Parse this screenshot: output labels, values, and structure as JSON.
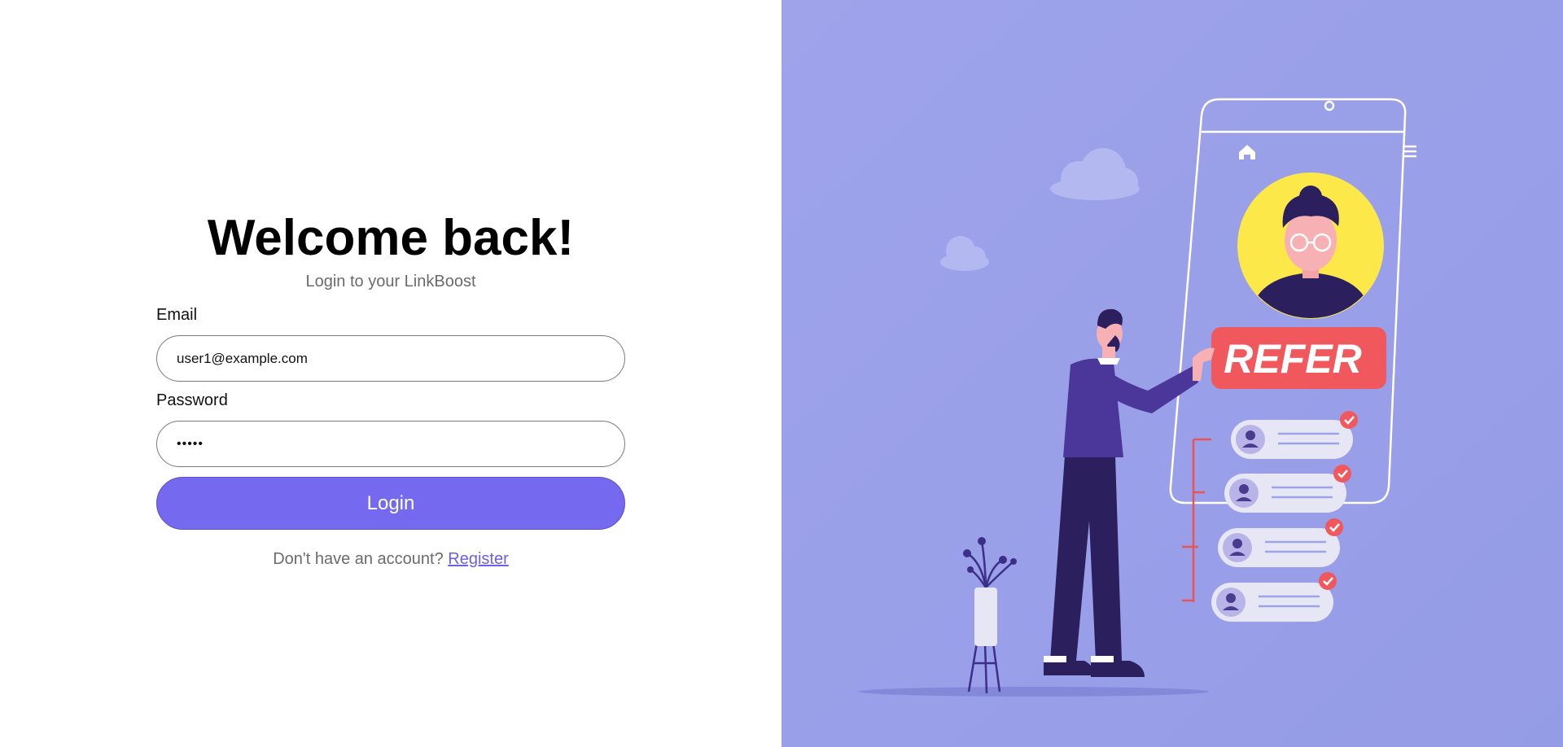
{
  "login": {
    "title": "Welcome back!",
    "subtitle": "Login to your LinkBoost",
    "email_label": "Email",
    "email_value": "user1@example.com",
    "password_label": "Password",
    "password_masked": "•••••",
    "login_button": "Login",
    "register_prompt": "Don't have an account?",
    "register_link": "Register"
  },
  "illustration": {
    "badge_text": "REFER",
    "icons": [
      "home-icon",
      "menu-icon",
      "checkmark-icon",
      "user-icon",
      "cloud",
      "plant-pot"
    ],
    "colors": {
      "background": "#9aa0e8",
      "accent": "#7569ef",
      "badge": "#f0585d",
      "avatar_circle": "#fde84a",
      "person_suit": "#3b2f8a"
    }
  }
}
